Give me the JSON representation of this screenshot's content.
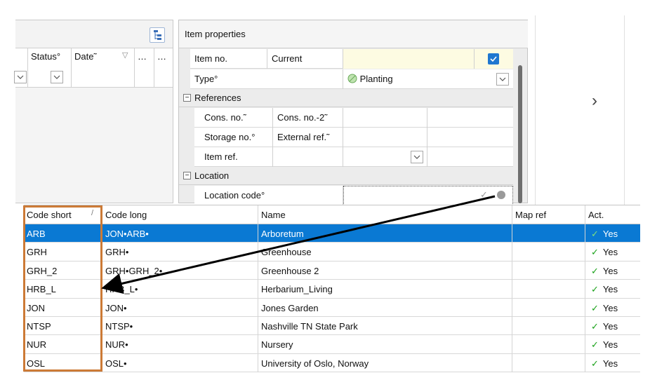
{
  "left_grid": {
    "columns": [
      "Status°",
      "Date˜",
      "…",
      "…"
    ]
  },
  "properties": {
    "title": "Item properties",
    "item_no_label": "Item no.",
    "item_no_value": "Current",
    "type_label": "Type°",
    "type_value": "Planting",
    "references_label": "References",
    "cons_no_label": "Cons. no.˜",
    "cons_no2_label": "Cons. no.-2˜",
    "storage_no_label": "Storage no.°",
    "external_ref_label": "External ref.˜",
    "item_ref_label": "Item ref.",
    "location_label": "Location",
    "location_code_label": "Location code°"
  },
  "nav": {
    "next_label": "›"
  },
  "code_grid": {
    "headers": {
      "code_short": "Code short",
      "code_long": "Code long",
      "name": "Name",
      "map_ref": "Map ref",
      "act": "Act."
    },
    "rows": [
      {
        "short": "ARB",
        "long": "JON•ARB•",
        "name": "Arboretum",
        "map": "",
        "act": "Yes"
      },
      {
        "short": "GRH",
        "long": "GRH•",
        "name": "Greenhouse",
        "map": "",
        "act": "Yes"
      },
      {
        "short": "GRH_2",
        "long": "GRH•GRH_2•",
        "name": "Greenhouse 2",
        "map": "",
        "act": "Yes"
      },
      {
        "short": "HRB_L",
        "long": "HRB_L•",
        "name": "Herbarium_Living",
        "map": "",
        "act": "Yes"
      },
      {
        "short": "JON",
        "long": "JON•",
        "name": "Jones Garden",
        "map": "",
        "act": "Yes"
      },
      {
        "short": "NTSP",
        "long": "NTSP•",
        "name": "Nashville TN State Park",
        "map": "",
        "act": "Yes"
      },
      {
        "short": "NUR",
        "long": "NUR•",
        "name": "Nursery",
        "map": "",
        "act": "Yes"
      },
      {
        "short": "OSL",
        "long": "OSL•",
        "name": "University of Oslo, Norway",
        "map": "",
        "act": "Yes"
      }
    ]
  },
  "colors": {
    "selection": "#0a79d3",
    "highlight_box": "#cc7a36",
    "item_no_field": "#fdfbe2",
    "check": "#1aa21a"
  }
}
